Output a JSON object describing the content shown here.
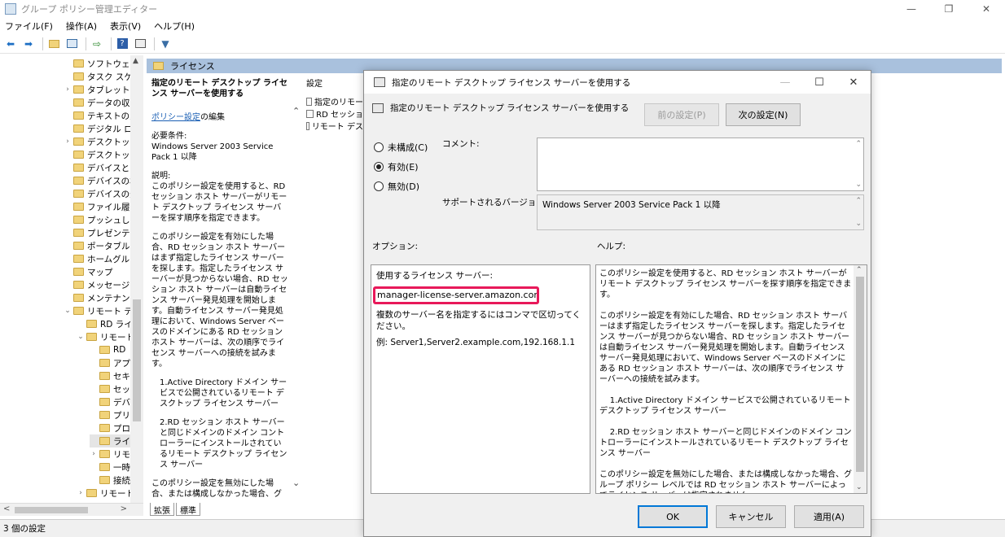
{
  "window": {
    "title": "グループ ポリシー管理エディター",
    "minimize": "—",
    "restore": "❐",
    "close": "✕"
  },
  "menu": [
    "ファイル(F)",
    "操作(A)",
    "表示(V)",
    "ヘルプ(H)"
  ],
  "toolbar_icons": [
    "back-arrow-icon",
    "forward-arrow-icon",
    "folder-up-icon",
    "properties-icon",
    "export-icon",
    "help-icon",
    "view-icon",
    "filter-icon"
  ],
  "tree": {
    "items": [
      {
        "label": "ソフトウェア(",
        "indent": 1,
        "arrow": ""
      },
      {
        "label": "タスク スケジ",
        "indent": 1,
        "arrow": ""
      },
      {
        "label": "タブレット P",
        "indent": 1,
        "arrow": ">"
      },
      {
        "label": "データの収集",
        "indent": 1,
        "arrow": ""
      },
      {
        "label": "テキストの入",
        "indent": 1,
        "arrow": ""
      },
      {
        "label": "デジタル ロッ",
        "indent": 1,
        "arrow": ""
      },
      {
        "label": "デスクトップ",
        "indent": 1,
        "arrow": ">"
      },
      {
        "label": "デスクトップ",
        "indent": 1,
        "arrow": ""
      },
      {
        "label": "デバイスとド",
        "indent": 1,
        "arrow": ""
      },
      {
        "label": "デバイスの検",
        "indent": 1,
        "arrow": ""
      },
      {
        "label": "デバイスの登",
        "indent": 1,
        "arrow": ""
      },
      {
        "label": "ファイル履歴",
        "indent": 1,
        "arrow": ""
      },
      {
        "label": "プッシュして",
        "indent": 1,
        "arrow": ""
      },
      {
        "label": "プレゼンテー",
        "indent": 1,
        "arrow": ""
      },
      {
        "label": "ポータブル オ",
        "indent": 1,
        "arrow": ""
      },
      {
        "label": "ホームグルー",
        "indent": 1,
        "arrow": ""
      },
      {
        "label": "マップ",
        "indent": 1,
        "arrow": ""
      },
      {
        "label": "メッセージン",
        "indent": 1,
        "arrow": ""
      },
      {
        "label": "メンテナンス",
        "indent": 1,
        "arrow": ""
      },
      {
        "label": "リモート デス",
        "indent": 1,
        "arrow": "v"
      },
      {
        "label": "RD ライ",
        "indent": 2,
        "arrow": ""
      },
      {
        "label": "リモート",
        "indent": 2,
        "arrow": "v"
      },
      {
        "label": "RD",
        "indent": 3,
        "arrow": ""
      },
      {
        "label": "アプ",
        "indent": 3,
        "arrow": ""
      },
      {
        "label": "セキ",
        "indent": 3,
        "arrow": ""
      },
      {
        "label": "セッ",
        "indent": 3,
        "arrow": ""
      },
      {
        "label": "デバ",
        "indent": 3,
        "arrow": ""
      },
      {
        "label": "プリ",
        "indent": 3,
        "arrow": ""
      },
      {
        "label": "プロ",
        "indent": 3,
        "arrow": ""
      },
      {
        "label": "ライ",
        "indent": 3,
        "arrow": "",
        "selected": true
      },
      {
        "label": "リモ",
        "indent": 3,
        "arrow": ">"
      },
      {
        "label": "一時",
        "indent": 3,
        "arrow": ""
      },
      {
        "label": "接続",
        "indent": 3,
        "arrow": ""
      },
      {
        "label": "リモート",
        "indent": 2,
        "arrow": ">"
      }
    ]
  },
  "pane": {
    "header": "ライセンス",
    "settings_header": "設定",
    "settings": [
      "指定のリモート",
      "RD セッション",
      "リモート デスク"
    ]
  },
  "description": {
    "heading": "指定のリモート デスクトップ ライセンス サーバーを使用する",
    "edit_link": "ポリシー設定",
    "edit_suffix": "の編集",
    "requirements": "必要条件:\nWindows Server 2003 Service Pack 1 以降",
    "explanation": "説明:\nこのポリシー設定を使用すると、RD セッション ホスト サーバーがリモート デスクトップ ライセンス サーバーを探す順序を指定できます。",
    "enabled": "このポリシー設定を有効にした場合、RD セッション ホスト サーバーはまず指定したライセンス サーバーを探します。指定したライセンス サーバーが見つからない場合、RD セッション ホスト サーバーは自動ライセンス サーバー発見処理を開始します。自動ライセンス サーバー発見処理において、Windows Server ベースのドメインにある RD セッション ホスト サーバーは、次の順序でライセンス サーバーへの接続を試みます。",
    "item1": "1.Active Directory ドメイン サービスで公開されているリモート デスクトップ ライセンス サーバー",
    "item2": "2.RD セッション ホスト サーバーと同じドメインのドメイン コントローラーにインストールされているリモート デスクトップ ライセンス サーバー",
    "disabled": "このポリシー設定を無効にした場合、または構成しなかった場合、グループ ポリシー"
  },
  "tabs": [
    "拡張",
    "標準"
  ],
  "status": "3 個の設定",
  "dialog": {
    "title": "指定のリモート デスクトップ ライセンス サーバーを使用する",
    "heading": "指定のリモート デスクトップ ライセンス サーバーを使用する",
    "prev_button": "前の設定(P)",
    "next_button": "次の設定(N)",
    "radio_not_configured": "未構成(C)",
    "radio_enabled": "有効(E)",
    "radio_disabled": "無効(D)",
    "selected": "enabled",
    "comment_label": "コメント:",
    "supported_label": "サポートされるバージョン:",
    "supported_value": "Windows Server 2003 Service Pack 1 以降",
    "options_label": "オプション:",
    "help_label": "ヘルプ:",
    "options": {
      "server_label": "使用するライセンス サーバー:",
      "server_value": "manager-license-server.amazon.com",
      "hint": "複数のサーバー名を指定するにはコンマで区切ってください。",
      "example": "例: Server1,Server2.example.com,192.168.1.1"
    },
    "help": {
      "p1": "このポリシー設定を使用すると、RD セッション ホスト サーバーがリモート デスクトップ ライセンス サーバーを探す順序を指定できます。",
      "p2": "このポリシー設定を有効にした場合、RD セッション ホスト サーバーはまず指定したライセンス サーバーを探します。指定したライセンス サーバーが見つからない場合、RD セッション ホスト サーバーは自動ライセンス サーバー発見処理を開始します。自動ライセンス サーバー発見処理において、Windows Server ベースのドメインにある RD セッション ホスト サーバーは、次の順序でライセンス サーバーへの接続を試みます。",
      "p3": "    1.Active Directory ドメイン サービスで公開されているリモート デスクトップ ライセンス サーバー",
      "p4": "    2.RD セッション ホスト サーバーと同じドメインのドメイン コントローラーにインストールされているリモート デスクトップ ライセンス サーバー",
      "p5": "このポリシー設定を無効にした場合、または構成しなかった場合、グループ ポリシー レベルでは RD セッション ホスト サーバーによってライセンス サーバーは指定されません。"
    },
    "ok_button": "OK",
    "cancel_button": "キャンセル",
    "apply_button": "適用(A)"
  },
  "colors": {
    "header_bg": "#a9c1dd",
    "highlight_border": "#e8195a",
    "primary_button_border": "#0078d7",
    "link": "#1a5fb4"
  }
}
